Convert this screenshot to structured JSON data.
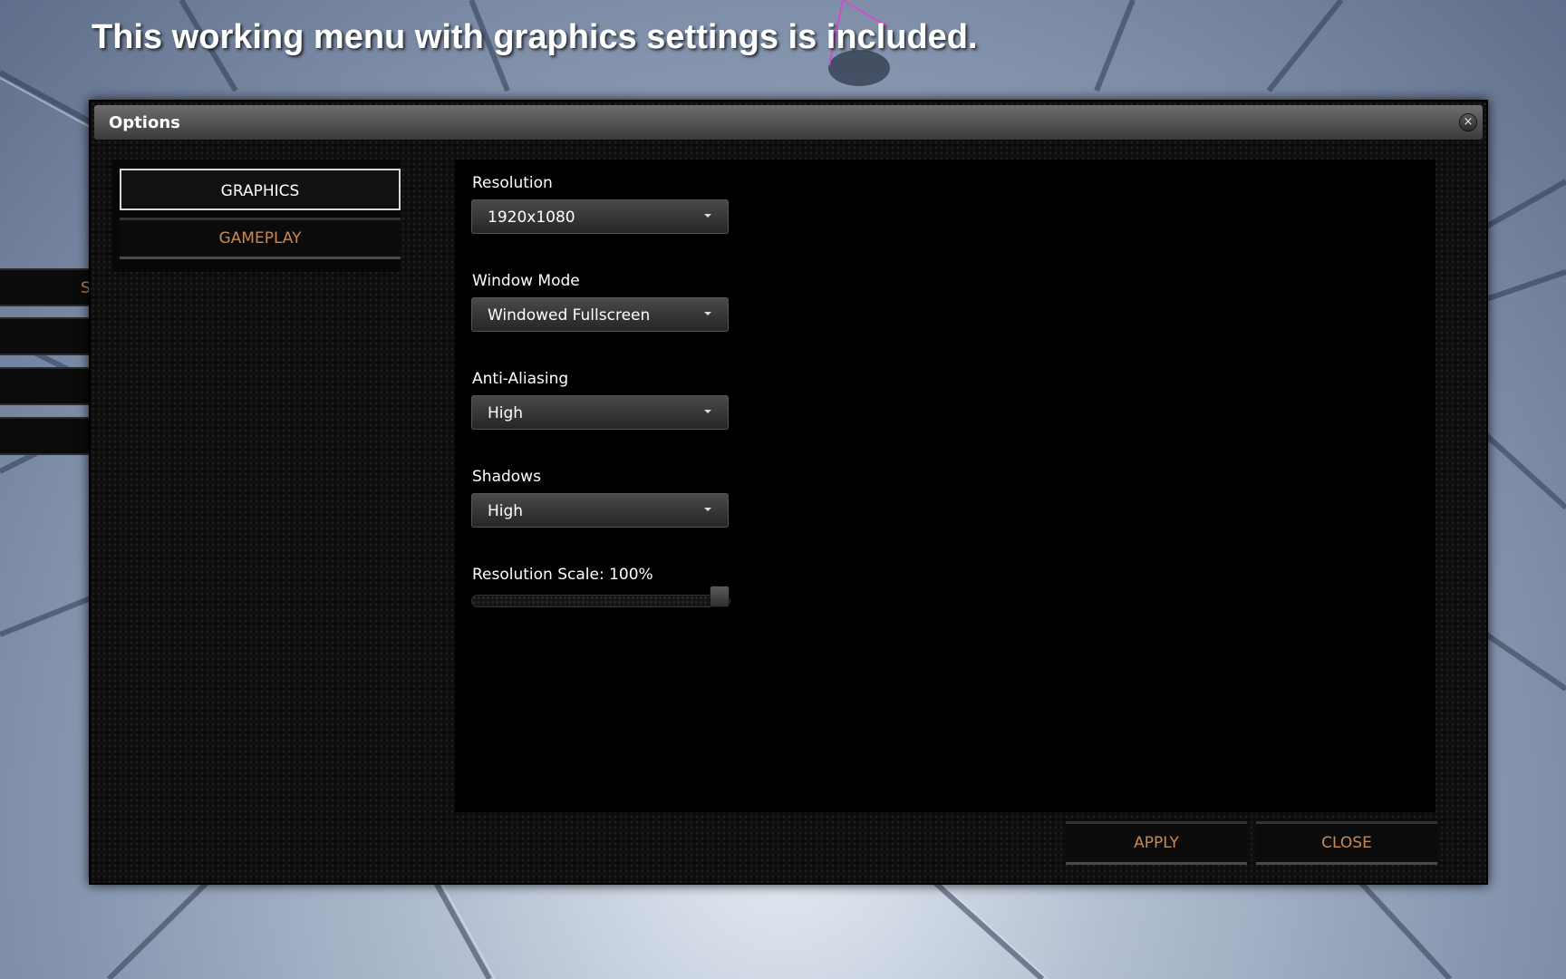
{
  "caption": "This working menu with graphics settings is included.",
  "side_menu": {
    "partial_letter": "S"
  },
  "window": {
    "title": "Options",
    "close_icon": "×",
    "tabs": [
      {
        "label": "GRAPHICS",
        "active": true
      },
      {
        "label": "GAMEPLAY",
        "active": false
      }
    ],
    "settings": {
      "resolution": {
        "label": "Resolution",
        "value": "1920x1080"
      },
      "window_mode": {
        "label": "Window Mode",
        "value": "Windowed Fullscreen"
      },
      "anti_aliasing": {
        "label": "Anti-Aliasing",
        "value": "High"
      },
      "shadows": {
        "label": "Shadows",
        "value": "High"
      },
      "resolution_scale": {
        "label": "Resolution Scale: 100%",
        "value_percent": 100
      }
    },
    "buttons": {
      "apply": "APPLY",
      "close": "CLOSE"
    }
  },
  "colors": {
    "accent_text": "#c98a55",
    "panel_bg": "#000000",
    "titlebar": "#5a5a5a"
  }
}
